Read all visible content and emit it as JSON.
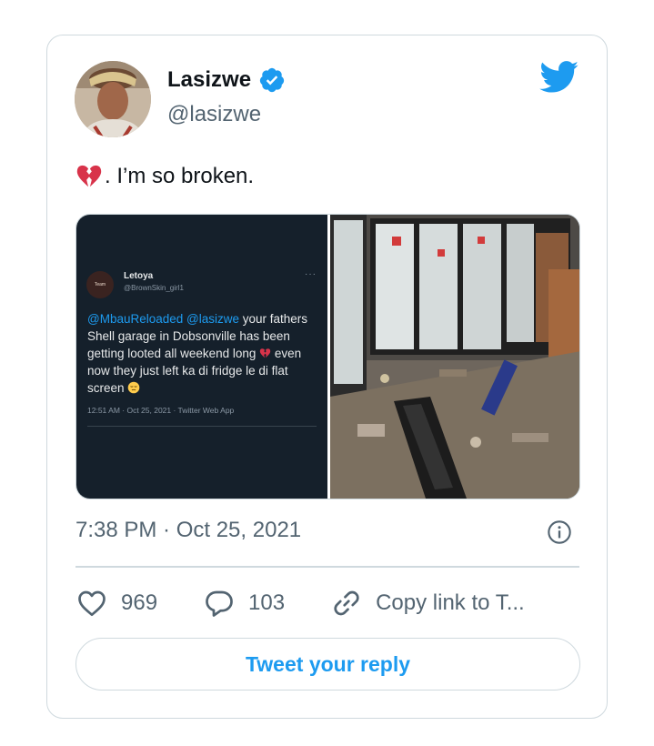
{
  "author": {
    "name": "Lasizwe",
    "handle": "@lasizwe",
    "verified": true
  },
  "tweet": {
    "emoji": "broken-heart",
    "text": ". I’m so broken.",
    "timestamp": "7:38 PM · Oct 25, 2021"
  },
  "embedded_screenshot": {
    "avatar_text": "Team",
    "name": "Letoya",
    "handle": "@BrownSkin_girl1",
    "mention1": "@MbauReloaded",
    "mention2": "@lasizwe",
    "text_part1": " your fathers Shell garage in Dobsonville has been getting looted all weekend long ",
    "text_part2": " even now they just left ka di fridge le di flat screen ",
    "meta": "12:51 AM · Oct 25, 2021 · Twitter Web App"
  },
  "photo": {
    "description_icon": "looted-store-photo"
  },
  "actions": {
    "likes": "969",
    "replies": "103",
    "copy_link": "Copy link to T..."
  },
  "reply_button": "Tweet your reply",
  "colors": {
    "accent": "#1d9bf0",
    "text": "#0f1419",
    "secondary": "#536471",
    "border": "#cfd9de",
    "heart": "#d8334a"
  }
}
